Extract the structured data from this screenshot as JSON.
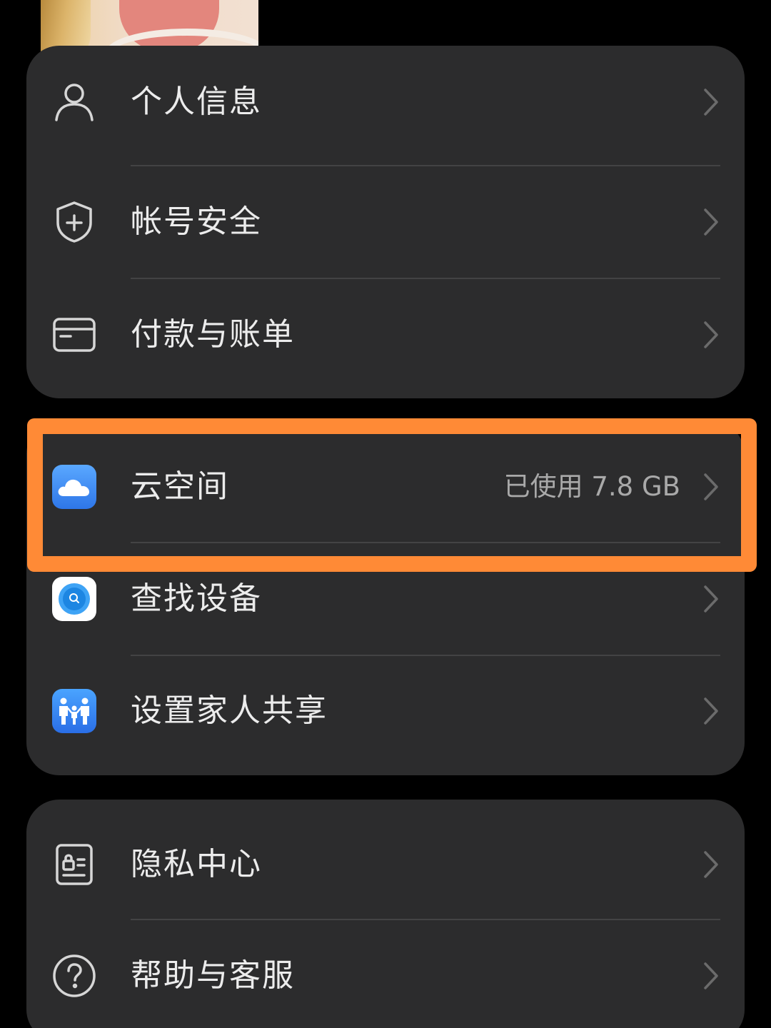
{
  "account_menu": {
    "items": [
      {
        "label": "个人信息",
        "icon": "person-icon"
      },
      {
        "label": "帐号安全",
        "icon": "shield-plus-icon"
      },
      {
        "label": "付款与账单",
        "icon": "card-icon"
      }
    ]
  },
  "services_menu": {
    "items": [
      {
        "label": "云空间",
        "value": "已使用 7.8 GB",
        "icon": "cloud-icon"
      },
      {
        "label": "查找设备",
        "icon": "find-device-icon"
      },
      {
        "label": "设置家人共享",
        "icon": "family-icon"
      }
    ]
  },
  "support_menu": {
    "items": [
      {
        "label": "隐私中心",
        "icon": "privacy-icon"
      },
      {
        "label": "帮助与客服",
        "icon": "help-icon"
      }
    ]
  },
  "colors": {
    "background": "#000000",
    "card": "#2c2c2d",
    "highlight": "#ff8a36",
    "cloud_blue": "#3d8cf0"
  }
}
